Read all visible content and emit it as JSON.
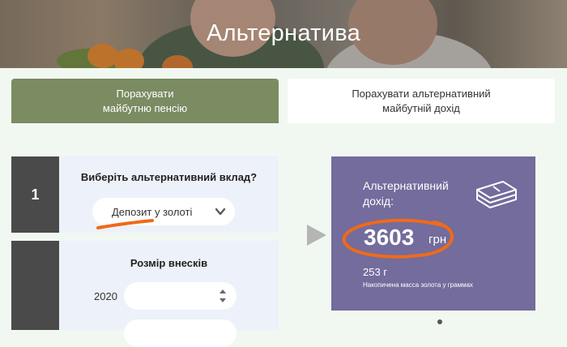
{
  "hero": {
    "title": "Альтернатива"
  },
  "tabs": [
    {
      "label_line1": "Порахувати",
      "label_line2": "майбутню пенсію"
    },
    {
      "label_line1": "Порахувати альтернативний",
      "label_line2": "майбутній дохід"
    }
  ],
  "step1": {
    "number": "1",
    "question": "Виберіть альтернативний вклад?",
    "select_value": "Депозит у золоті"
  },
  "step2": {
    "title": "Розмір внесків",
    "year": "2020",
    "amount_value": ""
  },
  "result": {
    "label": "Альтернативний дохід:",
    "amount": "3603",
    "currency": "грн",
    "grams": "253 г",
    "grams_label": "Накопичена масса золота у граммах"
  },
  "colors": {
    "active_tab": "#7b8b62",
    "result_panel": "#736c9c",
    "highlight": "#ef6a1a",
    "step_number_bg": "#4a4a4a"
  },
  "icons": [
    "chevron-down-icon",
    "spinner-icon",
    "play-arrow-icon",
    "money-stack-icon"
  ]
}
